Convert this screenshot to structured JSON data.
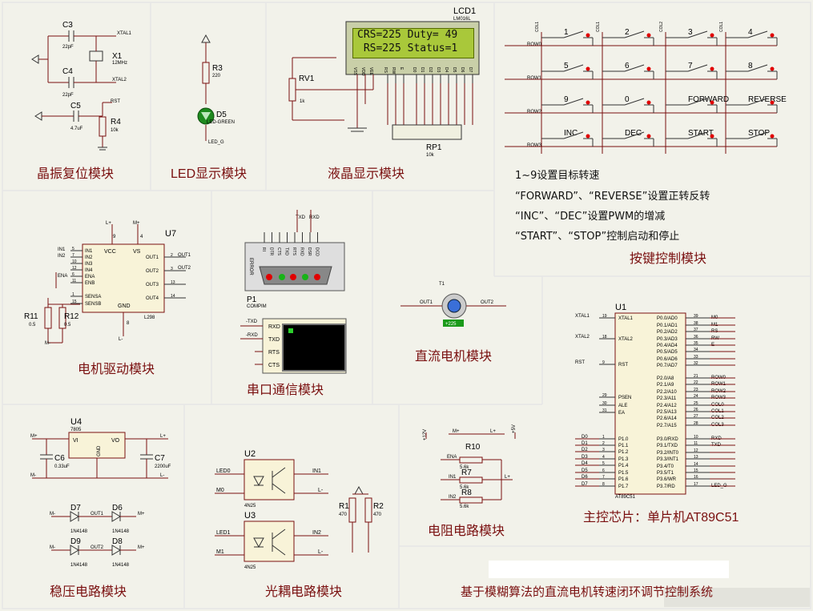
{
  "modules": {
    "crystal_reset": "晶振复位模块",
    "led_display": "LED显示模块",
    "lcd_display": "液晶显示模块",
    "keypad": "按键控制模块",
    "motor_drive": "电机驱动模块",
    "serial": "串口通信模块",
    "dc_motor": "直流电机模块",
    "main_chip": "主控芯片：单片机AT89C51",
    "regulator": "稳压电路模块",
    "optocoupler": "光耦电路模块",
    "resistor": "电阻电路模块",
    "system_title": "基于模糊算法的直流电机转速闭环调节控制系统"
  },
  "keypad_notes": [
    "1~9设置目标转速",
    "“FORWARD”、“REVERSE”设置正转反转",
    "“INC”、“DEC”设置PWM的增减",
    "“START”、“STOP”控制启动和停止"
  ],
  "lcd": {
    "ref": "LCD1",
    "model": "LM016L",
    "line1": "CRS=225 Duty= 49",
    "line2": " RS=225 Status=1",
    "pins": [
      "VSS",
      "VDD",
      "VEE",
      "RS",
      "RW",
      "E",
      "D0",
      "D1",
      "D2",
      "D3",
      "D4",
      "D5",
      "D6",
      "D7"
    ]
  },
  "keys": {
    "labels": [
      "1",
      "2",
      "3",
      "4",
      "5",
      "6",
      "7",
      "8",
      "9",
      "0",
      "FORWARD",
      "REVERSE",
      "INC",
      "DEC",
      "START",
      "STOP"
    ],
    "rows": [
      "ROW0",
      "ROW1",
      "ROW2",
      "ROW3"
    ],
    "cols": [
      "COL1",
      "COL1",
      "COL2",
      "COL1"
    ]
  },
  "crystal": {
    "c3": "C3",
    "c3_val": "22pF",
    "c4": "C4",
    "c4_val": "22pF",
    "x1": "X1",
    "x1_val": "12MHz",
    "c5": "C5",
    "c5_val": "4.7uF",
    "r4": "R4",
    "r4_val": "10k",
    "xtal1": "XTAL1",
    "xtal2": "XTAL2",
    "rst": "RST"
  },
  "led": {
    "r3": "R3",
    "r3_val": "220",
    "d5": "D5",
    "d5_val": "LED-GREEN",
    "net": "LED_G"
  },
  "pot": {
    "rv1": "RV1",
    "rv1_val": "1k",
    "rp1": "RP1",
    "rp1_val": "10k"
  },
  "l298": {
    "ref": "U7",
    "model": "L298",
    "left_pins": [
      "IN1",
      "IN2",
      "IN3",
      "IN4",
      "ENA",
      "ENB",
      "SENSA",
      "SENSB"
    ],
    "left_nums": [
      "5",
      "7",
      "10",
      "12",
      "6",
      "11",
      "1",
      "15"
    ],
    "right_pins": [
      "OUT1",
      "OUT2",
      "OUT3",
      "OUT4"
    ],
    "right_nums": [
      "2",
      "3",
      "13",
      "14"
    ],
    "top": [
      "VCC",
      "VS"
    ],
    "top_nums": [
      "9",
      "4"
    ],
    "gnd": "GND",
    "gnd_num": "8",
    "in1": "IN1",
    "in2": "IN2",
    "ena": "ENA",
    "out1": "OUT1",
    "out2": "OUT2",
    "l_plus": "L+",
    "m_plus": "M+",
    "l_minus": "L-",
    "m_minus": "M-",
    "r11": "R11",
    "r11_val": "0.5",
    "r12": "R12",
    "r12_val": "0.5"
  },
  "serial": {
    "p1": "P1",
    "p1_val": "COMPIM",
    "error": "ERROR",
    "pins": [
      "RI",
      "DTR",
      "CTS",
      "TXD",
      "RTS",
      "RXD",
      "DSR",
      "DCD"
    ],
    "txd": "TXD",
    "rxd": "RXD",
    "term_pins": [
      "RXD",
      "TXD",
      "RTS",
      "CTS"
    ],
    "tx_net": "-TXD",
    "rx_net": "-RXD"
  },
  "motor": {
    "ref": "T1",
    "out1": "OUT1",
    "out2": "OUT2",
    "reading": "+225"
  },
  "mcu": {
    "ref": "U1",
    "model": "AT89C51",
    "left_pins": [
      "XTAL1",
      "XTAL2",
      "RST",
      "PSEN",
      "ALE",
      "EA",
      "P1.0",
      "P1.1",
      "P1.2",
      "P1.3",
      "P1.4",
      "P1.5",
      "P1.6",
      "P1.7"
    ],
    "left_nums": [
      "19",
      "18",
      "9",
      "29",
      "30",
      "31",
      "1",
      "2",
      "3",
      "4",
      "5",
      "6",
      "7",
      "8"
    ],
    "left_nets": [
      "XTAL1",
      "XTAL2",
      "RST",
      "",
      "",
      "",
      "D0",
      "D1",
      "D2",
      "D3",
      "D4",
      "D5",
      "D6",
      "D7"
    ],
    "right_pins": [
      "P0.0/AD0",
      "P0.1/AD1",
      "P0.2/AD2",
      "P0.3/AD3",
      "P0.4/AD4",
      "P0.5/AD5",
      "P0.6/AD6",
      "P0.7/AD7",
      "P2.0/A8",
      "P2.1/A9",
      "P2.2/A10",
      "P2.3/A11",
      "P2.4/A12",
      "P2.5/A13",
      "P2.6/A14",
      "P2.7/A15",
      "P3.0/RXD",
      "P3.1/TXD",
      "P3.2/INT0",
      "P3.3/INT1",
      "P3.4/T0",
      "P3.5/T1",
      "P3.6/WR",
      "P3.7/RD"
    ],
    "right_nums": [
      "39",
      "38",
      "37",
      "36",
      "35",
      "34",
      "33",
      "32",
      "21",
      "22",
      "23",
      "24",
      "25",
      "26",
      "27",
      "28",
      "10",
      "11",
      "12",
      "13",
      "14",
      "15",
      "16",
      "17"
    ],
    "right_nets": [
      "M0",
      "M1",
      "RS",
      "RW",
      "E",
      "",
      "",
      "",
      "ROW0",
      "ROW1",
      "ROW2",
      "ROW3",
      "COL0",
      "COL1",
      "COL2",
      "COL3",
      "RXD",
      "TXD",
      "",
      "",
      "",
      "",
      "",
      "LED_G"
    ]
  },
  "regulator": {
    "u4": "U4",
    "u4_val": "7805",
    "vi": "VI",
    "vo": "VO",
    "gnd": "GND",
    "c6": "C6",
    "c6_val": "0.33uF",
    "c7": "C7",
    "c7_val": "2200uF",
    "m_plus": "M+",
    "m_minus": "M-",
    "l_plus": "L+",
    "l_minus": "L-",
    "diodes": [
      "D7",
      "D6",
      "D9",
      "D8"
    ],
    "diode_val": "1N4148",
    "out1": "OUT1",
    "out2": "OUT2"
  },
  "opto": {
    "u2": "U2",
    "u3": "U3",
    "model": "4N25",
    "in1": "IN1",
    "in2": "IN2",
    "led0": "LED0",
    "led1": "LED1",
    "m0": "M0",
    "m1": "M1",
    "l_minus": "L-",
    "r1": "R1",
    "r1_val": "470",
    "r2": "R2",
    "r2_val": "470"
  },
  "res": {
    "r10": "R10",
    "r7": "R7",
    "r8": "R8",
    "val": "5.6k",
    "ena": "ENA",
    "in1": "IN1",
    "in2": "IN2",
    "m_plus": "M+",
    "l_plus": "L+",
    "v12": "+12V",
    "v5": "+5V"
  },
  "colors": {
    "title": "#7a1010",
    "wire": "#7a1010",
    "lcd_bg": "#a9c83a",
    "led": "#1f8a1f",
    "bg": "#f2f2ea"
  }
}
